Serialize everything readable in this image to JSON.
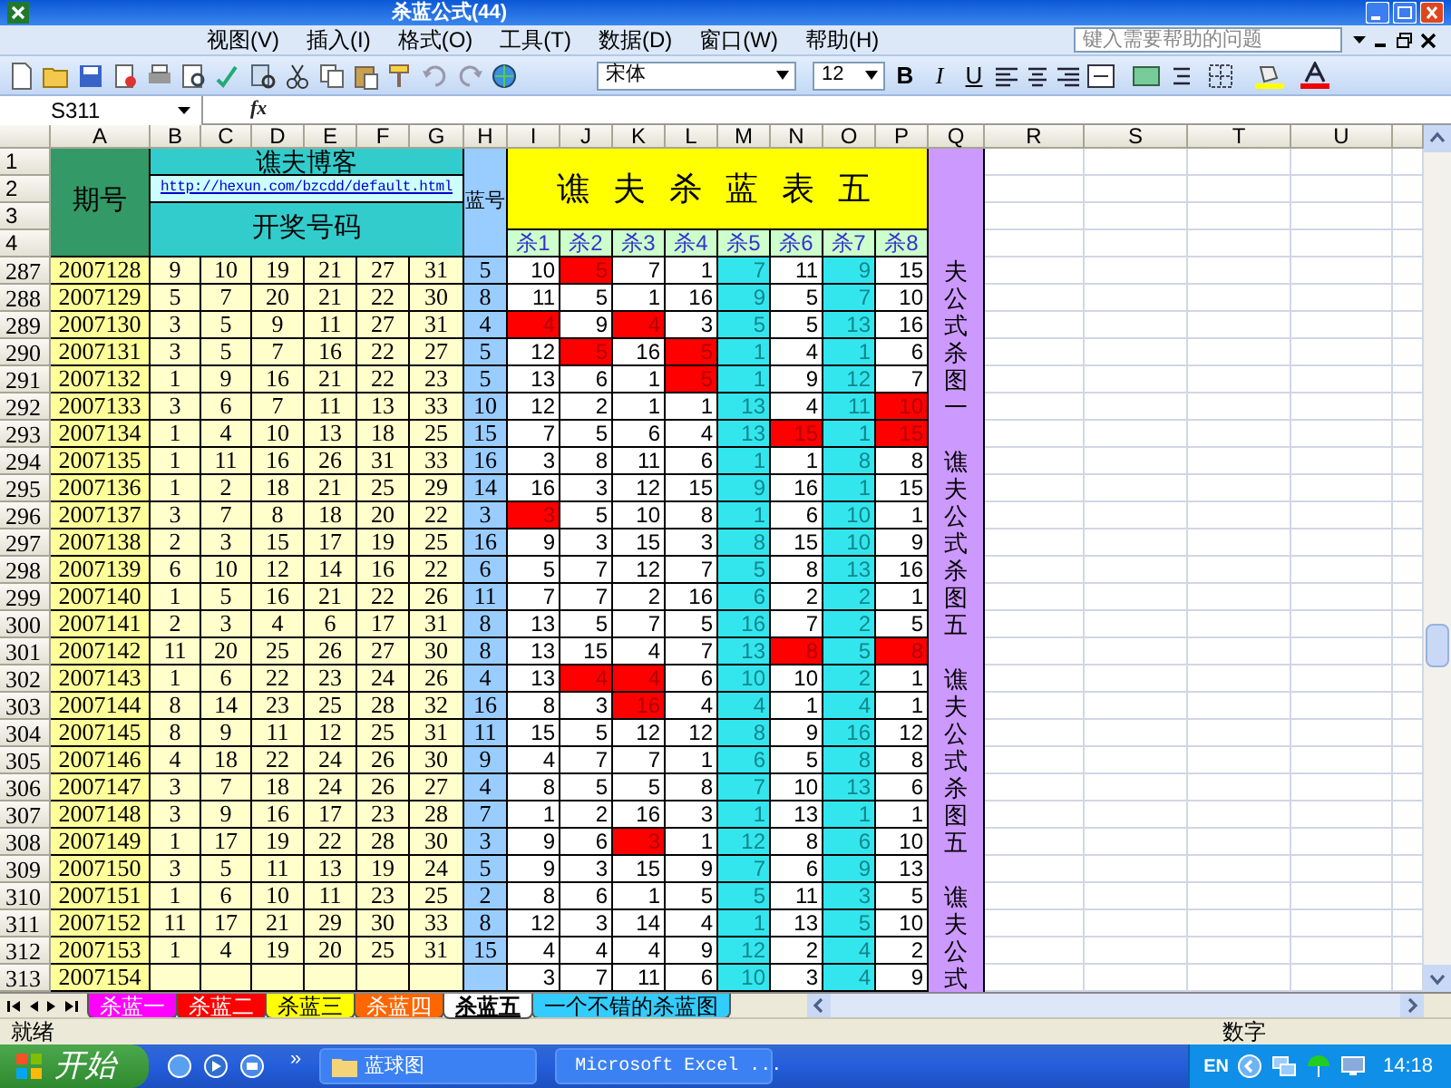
{
  "window": {
    "title": "杀蓝公式(44)"
  },
  "menu": [
    "视图(V)",
    "插入(I)",
    "格式(O)",
    "工具(T)",
    "数据(D)",
    "窗口(W)",
    "帮助(H)"
  ],
  "help_box": {
    "placeholder": "键入需要帮助的问题"
  },
  "format_toolbar": {
    "font": "宋体",
    "size": "12",
    "buttons": [
      "B",
      "I",
      "U"
    ]
  },
  "formula_bar": {
    "name_box": "S311",
    "fx": "fx"
  },
  "sheet": {
    "column_headers": [
      "A",
      "B",
      "C",
      "D",
      "E",
      "F",
      "G",
      "H",
      "I",
      "J",
      "K",
      "L",
      "M",
      "N",
      "O",
      "P",
      "Q",
      "R",
      "S",
      "T",
      "U"
    ],
    "header_row_numbers": [
      "1",
      "2",
      "3",
      "4"
    ],
    "period_label": "期号",
    "blog_title": "谯夫博客",
    "blog_link": "http://hexun.com/bzcdd/default.html",
    "draw_label": "开奖号码",
    "blue_label": "蓝号",
    "table_title": "谯 夫 杀 蓝 表 五",
    "kill_columns": [
      {
        "label": "杀1",
        "highlighted": false
      },
      {
        "label": "杀2",
        "highlighted": false
      },
      {
        "label": "杀3",
        "highlighted": false
      },
      {
        "label": "杀4",
        "highlighted": false
      },
      {
        "label": "杀5",
        "highlighted": true
      },
      {
        "label": "杀6",
        "highlighted": false
      },
      {
        "label": "杀7",
        "highlighted": true
      },
      {
        "label": "杀8",
        "highlighted": false
      }
    ],
    "rows": [
      {
        "number": "287",
        "period": "2007128",
        "balls": [
          "9",
          "10",
          "19",
          "21",
          "27",
          "31"
        ],
        "blue": "5",
        "kills": [
          {
            "value": "10",
            "hit": false
          },
          {
            "value": "5",
            "hit": true
          },
          {
            "value": "7",
            "hit": false
          },
          {
            "value": "1",
            "hit": false
          },
          {
            "value": "7",
            "hit": false
          },
          {
            "value": "11",
            "hit": false
          },
          {
            "value": "9",
            "hit": false
          },
          {
            "value": "15",
            "hit": false
          }
        ]
      },
      {
        "number": "288",
        "period": "2007129",
        "balls": [
          "5",
          "7",
          "20",
          "21",
          "22",
          "30"
        ],
        "blue": "8",
        "kills": [
          {
            "value": "11",
            "hit": false
          },
          {
            "value": "5",
            "hit": false
          },
          {
            "value": "1",
            "hit": false
          },
          {
            "value": "16",
            "hit": false
          },
          {
            "value": "9",
            "hit": false
          },
          {
            "value": "5",
            "hit": false
          },
          {
            "value": "7",
            "hit": false
          },
          {
            "value": "10",
            "hit": false
          }
        ]
      },
      {
        "number": "289",
        "period": "2007130",
        "balls": [
          "3",
          "5",
          "9",
          "11",
          "27",
          "31"
        ],
        "blue": "4",
        "kills": [
          {
            "value": "4",
            "hit": true
          },
          {
            "value": "9",
            "hit": false
          },
          {
            "value": "4",
            "hit": true
          },
          {
            "value": "3",
            "hit": false
          },
          {
            "value": "5",
            "hit": false
          },
          {
            "value": "5",
            "hit": false
          },
          {
            "value": "13",
            "hit": false
          },
          {
            "value": "16",
            "hit": false
          }
        ]
      },
      {
        "number": "290",
        "period": "2007131",
        "balls": [
          "3",
          "5",
          "7",
          "16",
          "22",
          "27"
        ],
        "blue": "5",
        "kills": [
          {
            "value": "12",
            "hit": false
          },
          {
            "value": "5",
            "hit": true
          },
          {
            "value": "16",
            "hit": false
          },
          {
            "value": "5",
            "hit": true
          },
          {
            "value": "1",
            "hit": false
          },
          {
            "value": "4",
            "hit": false
          },
          {
            "value": "1",
            "hit": false
          },
          {
            "value": "6",
            "hit": false
          }
        ]
      },
      {
        "number": "291",
        "period": "2007132",
        "balls": [
          "1",
          "9",
          "16",
          "21",
          "22",
          "23"
        ],
        "blue": "5",
        "kills": [
          {
            "value": "13",
            "hit": false
          },
          {
            "value": "6",
            "hit": false
          },
          {
            "value": "1",
            "hit": false
          },
          {
            "value": "5",
            "hit": true
          },
          {
            "value": "1",
            "hit": false
          },
          {
            "value": "9",
            "hit": false
          },
          {
            "value": "12",
            "hit": false
          },
          {
            "value": "7",
            "hit": false
          }
        ]
      },
      {
        "number": "292",
        "period": "2007133",
        "balls": [
          "3",
          "6",
          "7",
          "11",
          "13",
          "33"
        ],
        "blue": "10",
        "kills": [
          {
            "value": "12",
            "hit": false
          },
          {
            "value": "2",
            "hit": false
          },
          {
            "value": "1",
            "hit": false
          },
          {
            "value": "1",
            "hit": false
          },
          {
            "value": "13",
            "hit": false
          },
          {
            "value": "4",
            "hit": false
          },
          {
            "value": "11",
            "hit": false
          },
          {
            "value": "10",
            "hit": true
          }
        ]
      },
      {
        "number": "293",
        "period": "2007134",
        "balls": [
          "1",
          "4",
          "10",
          "13",
          "18",
          "25"
        ],
        "blue": "15",
        "kills": [
          {
            "value": "7",
            "hit": false
          },
          {
            "value": "5",
            "hit": false
          },
          {
            "value": "6",
            "hit": false
          },
          {
            "value": "4",
            "hit": false
          },
          {
            "value": "13",
            "hit": false
          },
          {
            "value": "15",
            "hit": true
          },
          {
            "value": "1",
            "hit": false
          },
          {
            "value": "15",
            "hit": true
          }
        ]
      },
      {
        "number": "294",
        "period": "2007135",
        "balls": [
          "1",
          "11",
          "16",
          "26",
          "31",
          "33"
        ],
        "blue": "16",
        "kills": [
          {
            "value": "3",
            "hit": false
          },
          {
            "value": "8",
            "hit": false
          },
          {
            "value": "11",
            "hit": false
          },
          {
            "value": "6",
            "hit": false
          },
          {
            "value": "1",
            "hit": false
          },
          {
            "value": "1",
            "hit": false
          },
          {
            "value": "8",
            "hit": false
          },
          {
            "value": "8",
            "hit": false
          }
        ]
      },
      {
        "number": "295",
        "period": "2007136",
        "balls": [
          "1",
          "2",
          "18",
          "21",
          "25",
          "29"
        ],
        "blue": "14",
        "kills": [
          {
            "value": "16",
            "hit": false
          },
          {
            "value": "3",
            "hit": false
          },
          {
            "value": "12",
            "hit": false
          },
          {
            "value": "15",
            "hit": false
          },
          {
            "value": "9",
            "hit": false
          },
          {
            "value": "16",
            "hit": false
          },
          {
            "value": "1",
            "hit": false
          },
          {
            "value": "15",
            "hit": false
          }
        ]
      },
      {
        "number": "296",
        "period": "2007137",
        "balls": [
          "3",
          "7",
          "8",
          "18",
          "20",
          "22"
        ],
        "blue": "3",
        "kills": [
          {
            "value": "3",
            "hit": true
          },
          {
            "value": "5",
            "hit": false
          },
          {
            "value": "10",
            "hit": false
          },
          {
            "value": "8",
            "hit": false
          },
          {
            "value": "1",
            "hit": false
          },
          {
            "value": "6",
            "hit": false
          },
          {
            "value": "10",
            "hit": false
          },
          {
            "value": "1",
            "hit": false
          }
        ]
      },
      {
        "number": "297",
        "period": "2007138",
        "balls": [
          "2",
          "3",
          "15",
          "17",
          "19",
          "25"
        ],
        "blue": "16",
        "kills": [
          {
            "value": "9",
            "hit": false
          },
          {
            "value": "3",
            "hit": false
          },
          {
            "value": "15",
            "hit": false
          },
          {
            "value": "3",
            "hit": false
          },
          {
            "value": "8",
            "hit": false
          },
          {
            "value": "15",
            "hit": false
          },
          {
            "value": "10",
            "hit": false
          },
          {
            "value": "9",
            "hit": false
          }
        ]
      },
      {
        "number": "298",
        "period": "2007139",
        "balls": [
          "6",
          "10",
          "12",
          "14",
          "16",
          "22"
        ],
        "blue": "6",
        "kills": [
          {
            "value": "5",
            "hit": false
          },
          {
            "value": "7",
            "hit": false
          },
          {
            "value": "12",
            "hit": false
          },
          {
            "value": "7",
            "hit": false
          },
          {
            "value": "5",
            "hit": false
          },
          {
            "value": "8",
            "hit": false
          },
          {
            "value": "13",
            "hit": false
          },
          {
            "value": "16",
            "hit": false
          }
        ]
      },
      {
        "number": "299",
        "period": "2007140",
        "balls": [
          "1",
          "5",
          "16",
          "21",
          "22",
          "26"
        ],
        "blue": "11",
        "kills": [
          {
            "value": "7",
            "hit": false
          },
          {
            "value": "7",
            "hit": false
          },
          {
            "value": "2",
            "hit": false
          },
          {
            "value": "16",
            "hit": false
          },
          {
            "value": "6",
            "hit": false
          },
          {
            "value": "2",
            "hit": false
          },
          {
            "value": "2",
            "hit": false
          },
          {
            "value": "1",
            "hit": false
          }
        ]
      },
      {
        "number": "300",
        "period": "2007141",
        "balls": [
          "2",
          "3",
          "4",
          "6",
          "17",
          "31"
        ],
        "blue": "8",
        "kills": [
          {
            "value": "13",
            "hit": false
          },
          {
            "value": "5",
            "hit": false
          },
          {
            "value": "7",
            "hit": false
          },
          {
            "value": "5",
            "hit": false
          },
          {
            "value": "16",
            "hit": false
          },
          {
            "value": "7",
            "hit": false
          },
          {
            "value": "2",
            "hit": false
          },
          {
            "value": "5",
            "hit": false
          }
        ]
      },
      {
        "number": "301",
        "period": "2007142",
        "balls": [
          "11",
          "20",
          "25",
          "26",
          "27",
          "30"
        ],
        "blue": "8",
        "kills": [
          {
            "value": "13",
            "hit": false
          },
          {
            "value": "15",
            "hit": false
          },
          {
            "value": "4",
            "hit": false
          },
          {
            "value": "7",
            "hit": false
          },
          {
            "value": "13",
            "hit": false
          },
          {
            "value": "8",
            "hit": true
          },
          {
            "value": "5",
            "hit": false
          },
          {
            "value": "8",
            "hit": true
          }
        ]
      },
      {
        "number": "302",
        "period": "2007143",
        "balls": [
          "1",
          "6",
          "22",
          "23",
          "24",
          "26"
        ],
        "blue": "4",
        "kills": [
          {
            "value": "13",
            "hit": false
          },
          {
            "value": "4",
            "hit": true
          },
          {
            "value": "4",
            "hit": true
          },
          {
            "value": "6",
            "hit": false
          },
          {
            "value": "10",
            "hit": false
          },
          {
            "value": "10",
            "hit": false
          },
          {
            "value": "2",
            "hit": false
          },
          {
            "value": "1",
            "hit": false
          }
        ]
      },
      {
        "number": "303",
        "period": "2007144",
        "balls": [
          "8",
          "14",
          "23",
          "25",
          "28",
          "32"
        ],
        "blue": "16",
        "kills": [
          {
            "value": "8",
            "hit": false
          },
          {
            "value": "3",
            "hit": false
          },
          {
            "value": "16",
            "hit": true
          },
          {
            "value": "4",
            "hit": false
          },
          {
            "value": "4",
            "hit": false
          },
          {
            "value": "1",
            "hit": false
          },
          {
            "value": "4",
            "hit": false
          },
          {
            "value": "1",
            "hit": false
          }
        ]
      },
      {
        "number": "304",
        "period": "2007145",
        "balls": [
          "8",
          "9",
          "11",
          "12",
          "25",
          "31"
        ],
        "blue": "11",
        "kills": [
          {
            "value": "15",
            "hit": false
          },
          {
            "value": "5",
            "hit": false
          },
          {
            "value": "12",
            "hit": false
          },
          {
            "value": "12",
            "hit": false
          },
          {
            "value": "8",
            "hit": false
          },
          {
            "value": "9",
            "hit": false
          },
          {
            "value": "16",
            "hit": false
          },
          {
            "value": "12",
            "hit": false
          }
        ]
      },
      {
        "number": "305",
        "period": "2007146",
        "balls": [
          "4",
          "18",
          "22",
          "24",
          "26",
          "30"
        ],
        "blue": "9",
        "kills": [
          {
            "value": "4",
            "hit": false
          },
          {
            "value": "7",
            "hit": false
          },
          {
            "value": "7",
            "hit": false
          },
          {
            "value": "1",
            "hit": false
          },
          {
            "value": "6",
            "hit": false
          },
          {
            "value": "5",
            "hit": false
          },
          {
            "value": "8",
            "hit": false
          },
          {
            "value": "8",
            "hit": false
          }
        ]
      },
      {
        "number": "306",
        "period": "2007147",
        "balls": [
          "3",
          "7",
          "18",
          "24",
          "26",
          "27"
        ],
        "blue": "4",
        "kills": [
          {
            "value": "8",
            "hit": false
          },
          {
            "value": "5",
            "hit": false
          },
          {
            "value": "5",
            "hit": false
          },
          {
            "value": "8",
            "hit": false
          },
          {
            "value": "7",
            "hit": false
          },
          {
            "value": "10",
            "hit": false
          },
          {
            "value": "13",
            "hit": false
          },
          {
            "value": "6",
            "hit": false
          }
        ]
      },
      {
        "number": "307",
        "period": "2007148",
        "balls": [
          "3",
          "9",
          "16",
          "17",
          "23",
          "28"
        ],
        "blue": "7",
        "kills": [
          {
            "value": "1",
            "hit": false
          },
          {
            "value": "2",
            "hit": false
          },
          {
            "value": "16",
            "hit": false
          },
          {
            "value": "3",
            "hit": false
          },
          {
            "value": "1",
            "hit": false
          },
          {
            "value": "13",
            "hit": false
          },
          {
            "value": "1",
            "hit": false
          },
          {
            "value": "1",
            "hit": false
          }
        ]
      },
      {
        "number": "308",
        "period": "2007149",
        "balls": [
          "1",
          "17",
          "19",
          "22",
          "28",
          "30"
        ],
        "blue": "3",
        "kills": [
          {
            "value": "9",
            "hit": false
          },
          {
            "value": "6",
            "hit": false
          },
          {
            "value": "3",
            "hit": true
          },
          {
            "value": "1",
            "hit": false
          },
          {
            "value": "12",
            "hit": false
          },
          {
            "value": "8",
            "hit": false
          },
          {
            "value": "6",
            "hit": false
          },
          {
            "value": "10",
            "hit": false
          }
        ]
      },
      {
        "number": "309",
        "period": "2007150",
        "balls": [
          "3",
          "5",
          "11",
          "13",
          "19",
          "24"
        ],
        "blue": "5",
        "kills": [
          {
            "value": "9",
            "hit": false
          },
          {
            "value": "3",
            "hit": false
          },
          {
            "value": "15",
            "hit": false
          },
          {
            "value": "9",
            "hit": false
          },
          {
            "value": "7",
            "hit": false
          },
          {
            "value": "6",
            "hit": false
          },
          {
            "value": "9",
            "hit": false
          },
          {
            "value": "13",
            "hit": false
          }
        ]
      },
      {
        "number": "310",
        "period": "2007151",
        "balls": [
          "1",
          "6",
          "10",
          "11",
          "23",
          "25"
        ],
        "blue": "2",
        "kills": [
          {
            "value": "8",
            "hit": false
          },
          {
            "value": "6",
            "hit": false
          },
          {
            "value": "1",
            "hit": false
          },
          {
            "value": "5",
            "hit": false
          },
          {
            "value": "5",
            "hit": false
          },
          {
            "value": "11",
            "hit": false
          },
          {
            "value": "3",
            "hit": false
          },
          {
            "value": "5",
            "hit": false
          }
        ]
      },
      {
        "number": "311",
        "period": "2007152",
        "balls": [
          "11",
          "17",
          "21",
          "29",
          "30",
          "33"
        ],
        "blue": "8",
        "kills": [
          {
            "value": "12",
            "hit": false
          },
          {
            "value": "3",
            "hit": false
          },
          {
            "value": "14",
            "hit": false
          },
          {
            "value": "4",
            "hit": false
          },
          {
            "value": "1",
            "hit": false
          },
          {
            "value": "13",
            "hit": false
          },
          {
            "value": "5",
            "hit": false
          },
          {
            "value": "10",
            "hit": false
          }
        ]
      },
      {
        "number": "312",
        "period": "2007153",
        "balls": [
          "1",
          "4",
          "19",
          "20",
          "25",
          "31"
        ],
        "blue": "15",
        "kills": [
          {
            "value": "4",
            "hit": false
          },
          {
            "value": "4",
            "hit": false
          },
          {
            "value": "4",
            "hit": false
          },
          {
            "value": "9",
            "hit": false
          },
          {
            "value": "12",
            "hit": false
          },
          {
            "value": "2",
            "hit": false
          },
          {
            "value": "4",
            "hit": false
          },
          {
            "value": "2",
            "hit": false
          }
        ]
      },
      {
        "number": "313",
        "period": "2007154",
        "balls": [],
        "kills": [
          {
            "value": "3",
            "hit": false
          },
          {
            "value": "7",
            "hit": false
          },
          {
            "value": "11",
            "hit": false
          },
          {
            "value": "6",
            "hit": false
          },
          {
            "value": "10",
            "hit": false
          },
          {
            "value": "3",
            "hit": false
          },
          {
            "value": "4",
            "hit": false
          },
          {
            "value": "9",
            "hit": false
          }
        ]
      }
    ],
    "notes": [
      "夫公式杀图一",
      "谯夫公式杀图五",
      "谯夫公式杀图五",
      "谯夫公式"
    ]
  },
  "sheet_tabs": [
    {
      "label": "杀蓝一",
      "color": "#ff00ff",
      "selected": false
    },
    {
      "label": "杀蓝二",
      "color": "#ff0000",
      "selected": false
    },
    {
      "label": "杀蓝三",
      "color": "#ffff00",
      "selected": false
    },
    {
      "label": "杀蓝四",
      "color": "#ff6600",
      "selected": false
    },
    {
      "label": "杀蓝五",
      "selected": true
    },
    {
      "label": "一个不错的杀蓝图",
      "color": "#33ccff",
      "selected": false
    }
  ],
  "status_bar": {
    "state": "就绪",
    "mode": "数字"
  },
  "taskbar": {
    "start": "开始",
    "overflow": "»",
    "tasks": [
      {
        "label": "蓝球图",
        "kind": "folder"
      },
      {
        "label": "Microsoft Excel ...",
        "kind": "excel"
      }
    ],
    "language": "EN",
    "time": "14:18"
  }
}
